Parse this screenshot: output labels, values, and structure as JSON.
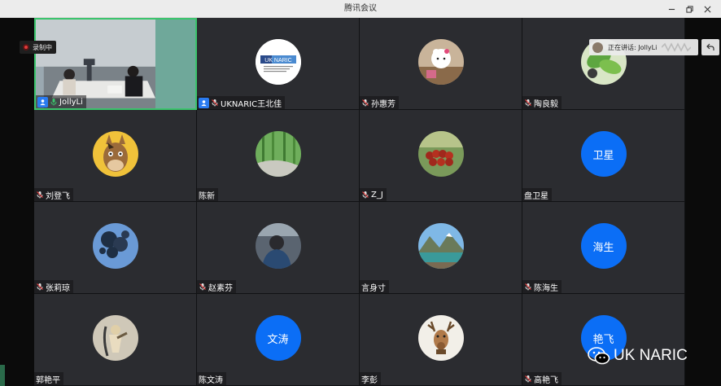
{
  "window": {
    "title": "腾讯会议"
  },
  "recording": {
    "label": "录制中"
  },
  "speaking": {
    "label": "正在讲话: JollyLi"
  },
  "watermark": {
    "text": "UK NARIC"
  },
  "colors": {
    "accent": "#0b6ef6",
    "active_border": "#3bc46c",
    "record": "#e23a3a",
    "tile_bg": "#2b2c30"
  },
  "participants": [
    {
      "name": "JollyLi",
      "type": "video",
      "host": true,
      "mic": "active",
      "active": true
    },
    {
      "name": "UKNARIC王北佳",
      "type": "logo",
      "host": true,
      "mic": "muted",
      "logo_text": "UK NARIC"
    },
    {
      "name": "孙惠芳",
      "type": "photo",
      "icon": "hello-kitty-photo-icon",
      "mic": "muted"
    },
    {
      "name": "陶良毅",
      "type": "photo",
      "icon": "green-leaf-photo-icon",
      "mic": "muted"
    },
    {
      "name": "刘登飞",
      "type": "photo",
      "icon": "cartoon-horse-avatar-icon",
      "mic": "muted"
    },
    {
      "name": "陈新",
      "type": "photo",
      "icon": "bamboo-forest-photo-icon",
      "mic": "none"
    },
    {
      "name": "Z_J",
      "type": "photo",
      "icon": "beaded-bracelet-photo-icon",
      "mic": "muted"
    },
    {
      "name": "盘卫星",
      "type": "text",
      "avatar_text": "卫星",
      "mic": "none"
    },
    {
      "name": "张莉琼",
      "type": "photo",
      "icon": "blue-tree-photo-icon",
      "mic": "muted"
    },
    {
      "name": "赵素芬",
      "type": "photo",
      "icon": "person-portrait-photo-icon",
      "mic": "muted"
    },
    {
      "name": "言身寸",
      "type": "photo",
      "icon": "mountain-lake-photo-icon",
      "mic": "none"
    },
    {
      "name": "陈海生",
      "type": "text",
      "avatar_text": "海生",
      "mic": "muted"
    },
    {
      "name": "郭艳平",
      "type": "photo",
      "icon": "sketch-figure-photo-icon",
      "mic": "none"
    },
    {
      "name": "陈文涛",
      "type": "text",
      "avatar_text": "文涛",
      "mic": "none"
    },
    {
      "name": "李彭",
      "type": "photo",
      "icon": "deer-head-photo-icon",
      "mic": "none"
    },
    {
      "name": "高艳飞",
      "type": "text",
      "avatar_text": "艳飞",
      "mic": "muted"
    }
  ]
}
